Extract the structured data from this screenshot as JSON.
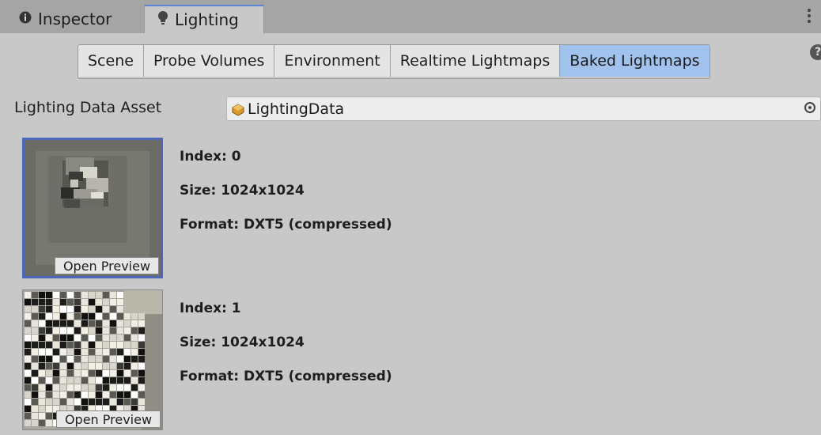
{
  "tabs": [
    {
      "label": "Inspector",
      "icon": "info-icon"
    },
    {
      "label": "Lighting",
      "icon": "lightbulb-icon"
    }
  ],
  "toolbar": {
    "buttons": [
      "Scene",
      "Probe Volumes",
      "Environment",
      "Realtime Lightmaps",
      "Baked Lightmaps"
    ],
    "active": "Baked Lightmaps"
  },
  "asset": {
    "label": "Lighting Data Asset",
    "value": "LightingData"
  },
  "lightmaps": [
    {
      "index": "Index: 0",
      "size": "Size: 1024x1024",
      "format": "Format: DXT5 (compressed)",
      "preview_label": "Open Preview",
      "selected": true
    },
    {
      "index": "Index: 1",
      "size": "Size: 1024x1024",
      "format": "Format: DXT5 (compressed)",
      "preview_label": "Open Preview",
      "selected": false
    }
  ],
  "colors": {
    "active_tab_accent": "#5a86d9",
    "active_button": "#a2c2ee",
    "selection_border": "#4a67b8"
  }
}
